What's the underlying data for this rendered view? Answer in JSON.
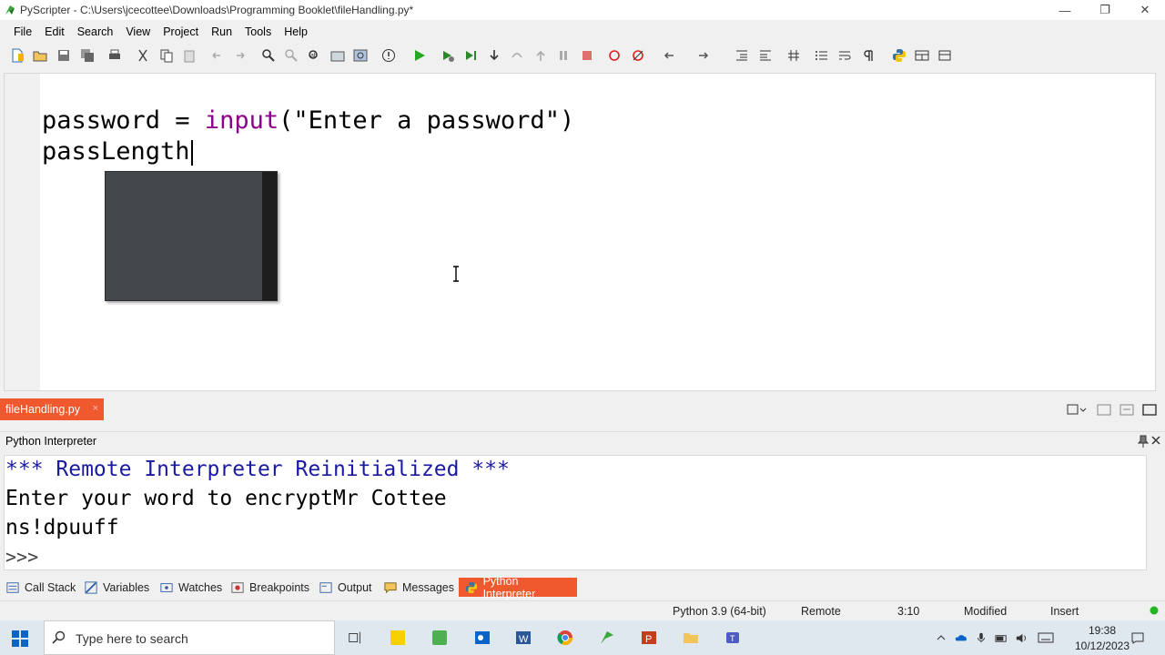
{
  "window": {
    "title": "PyScripter - C:\\Users\\jcecottee\\Downloads\\Programming Booklet\\fileHandling.py*",
    "minimize": "—",
    "maximize": "❐",
    "close": "✕"
  },
  "menu": [
    "File",
    "Edit",
    "Search",
    "View",
    "Project",
    "Run",
    "Tools",
    "Help"
  ],
  "editor": {
    "line1_var": "password = ",
    "line1_func": "input",
    "line1_rest": "(\"Enter a password\")",
    "line2": "passLength"
  },
  "file_tab": {
    "label": "fileHandling.py",
    "close": "×"
  },
  "interpreter": {
    "panel_title": "Python Interpreter",
    "lines": [
      "*** Remote Interpreter Reinitialized ***",
      "Enter your word to encryptMr Cottee",
      "ns!dpuuff"
    ],
    "prompt": ">>>"
  },
  "bottom_tabs": [
    "Call Stack",
    "Variables",
    "Watches",
    "Breakpoints",
    "Output",
    "Messages",
    "Python Interpreter"
  ],
  "status": {
    "python": "Python 3.9 (64-bit)",
    "engine": "Remote",
    "position": "3:10",
    "modified": "Modified",
    "mode": "Insert"
  },
  "taskbar": {
    "search_placeholder": "Type here to search",
    "time": "19:38",
    "date": "10/12/2023"
  },
  "colors": {
    "accent": "#f0592e",
    "keyword": "#8b008b",
    "interpreter_text": "#1a1aa0"
  }
}
